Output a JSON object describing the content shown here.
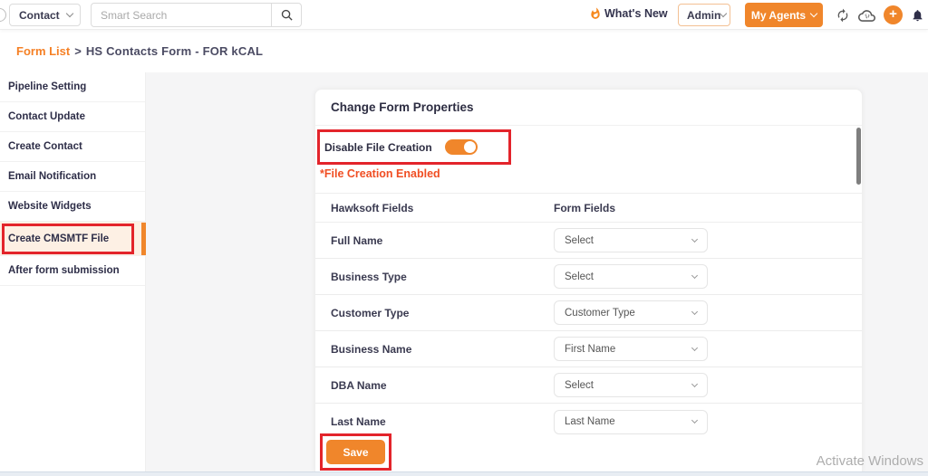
{
  "topbar": {
    "context_select": {
      "value": "Contact"
    },
    "search": {
      "placeholder": "Smart Search"
    },
    "whats_new_label": "What's New",
    "admin_select": {
      "value": "Admin"
    },
    "my_agents_label": "My Agents",
    "plus_label": "+"
  },
  "breadcrumb": {
    "link": "Form List",
    "separator": ">",
    "current": "HS Contacts Form - FOR kCAL"
  },
  "sidebar": {
    "items": [
      {
        "label": "Pipeline Setting",
        "active": false
      },
      {
        "label": "Contact Update",
        "active": false
      },
      {
        "label": "Create Contact",
        "active": false
      },
      {
        "label": "Email Notification",
        "active": false
      },
      {
        "label": "Website Widgets",
        "active": false
      },
      {
        "label": "Create CMSMTF File",
        "active": true
      },
      {
        "label": "After form submission",
        "active": false
      }
    ]
  },
  "main": {
    "card_title": "Change Form Properties",
    "toggle": {
      "label": "Disable File Creation",
      "state": "on"
    },
    "helper_text": "*File Creation Enabled",
    "table": {
      "headers": [
        "Hawksoft Fields",
        "Form Fields"
      ],
      "rows": [
        {
          "field": "Full Name",
          "value": "Select"
        },
        {
          "field": "Business Type",
          "value": "Select"
        },
        {
          "field": "Customer Type",
          "value": "Customer Type"
        },
        {
          "field": "Business Name",
          "value": "First Name"
        },
        {
          "field": "DBA Name",
          "value": "Select"
        },
        {
          "field": "Last Name",
          "value": "Last Name"
        }
      ]
    },
    "save_label": "Save"
  },
  "watermark": "Activate Windows",
  "colors": {
    "accent_orange": "#F0862B",
    "breadcrumb_orange": "#F58025",
    "annotation_red": "#E3242B",
    "helper_red": "#F04E23",
    "active_item_bg": "#FDF0E4"
  }
}
